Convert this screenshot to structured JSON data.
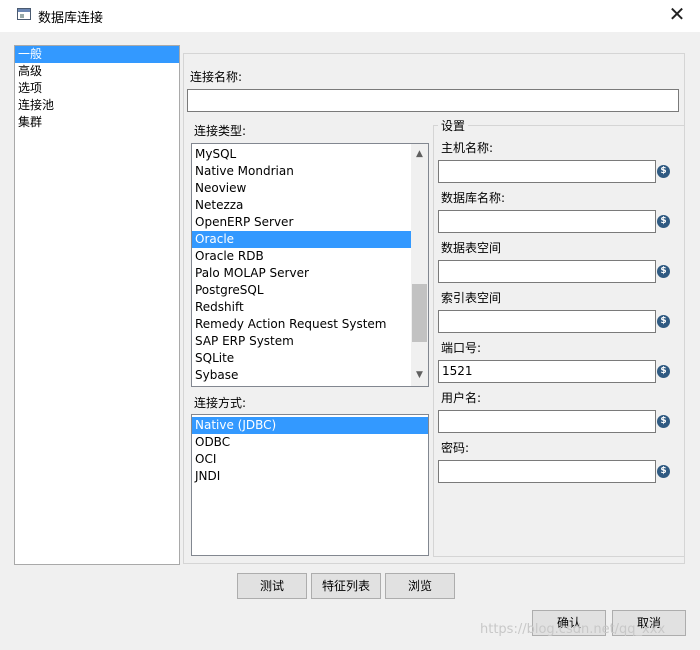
{
  "window": {
    "title": "数据库连接",
    "close_glyph": "✕"
  },
  "nav": {
    "items": [
      {
        "label": "一般",
        "selected": true
      },
      {
        "label": "高级",
        "selected": false
      },
      {
        "label": "选项",
        "selected": false
      },
      {
        "label": "连接池",
        "selected": false
      },
      {
        "label": "集群",
        "selected": false
      }
    ]
  },
  "connection_name": {
    "label": "连接名称:",
    "value": ""
  },
  "connection_type": {
    "label": "连接类型:",
    "items": [
      "MySQL",
      "Native Mondrian",
      "Neoview",
      "Netezza",
      "OpenERP Server",
      "Oracle",
      "Oracle RDB",
      "Palo MOLAP Server",
      "PostgreSQL",
      "Redshift",
      "Remedy Action Request System",
      "SAP ERP System",
      "SQLite",
      "Sybase"
    ],
    "selected": "Oracle"
  },
  "access": {
    "label": "连接方式:",
    "items": [
      "Native (JDBC)",
      "ODBC",
      "OCI",
      "JNDI"
    ],
    "selected": "Native (JDBC)"
  },
  "settings": {
    "title": "设置",
    "fields": [
      {
        "label": "主机名称:",
        "value": ""
      },
      {
        "label": "数据库名称:",
        "value": ""
      },
      {
        "label": "数据表空间",
        "value": ""
      },
      {
        "label": "索引表空间",
        "value": ""
      },
      {
        "label": "端口号:",
        "value": "1521"
      },
      {
        "label": "用户名:",
        "value": ""
      },
      {
        "label": "密码:",
        "value": ""
      }
    ],
    "var_icon_glyph": "$"
  },
  "buttons": {
    "test": "测试",
    "features": "特征列表",
    "explore": "浏览",
    "ok": "确认",
    "cancel": "取消"
  },
  "watermark": "https://blog.csdn.net/qq_xxx",
  "icons": [
    "window-icon",
    "close-icon",
    "variable-icon",
    "scroll-up-icon",
    "scroll-down-icon"
  ],
  "colors": {
    "selection": "#3399ff",
    "dialog_bg": "#f0f0f0",
    "variable_icon": "#2f5a82"
  }
}
